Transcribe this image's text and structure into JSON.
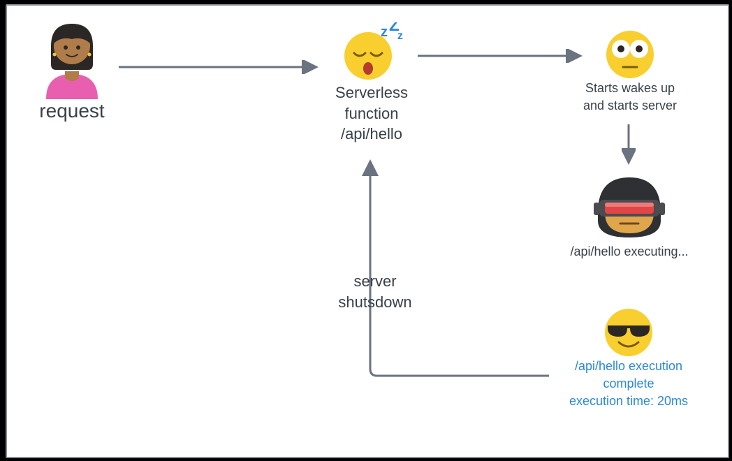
{
  "user": {
    "label": "request",
    "icon": "person-icon"
  },
  "serverless": {
    "label_line1": "Serverless",
    "label_line2": "function",
    "label_line3": "/api/hello",
    "icon": "sleepy-face-icon"
  },
  "wake": {
    "label_line1": "Starts wakes up",
    "label_line2": "and starts server",
    "icon": "wide-eyes-face-icon"
  },
  "executing": {
    "label": "/api/hello executing...",
    "icon": "robot-visor-icon"
  },
  "complete": {
    "label_line1": "/api/hello execution",
    "label_line2": "complete",
    "label_line3": "execution time: 20ms",
    "icon": "cool-sunglasses-icon"
  },
  "shutdown": {
    "label_line1": "server",
    "label_line2": "shutsdown"
  },
  "colors": {
    "arrow": "#6b7280",
    "text": "#394049",
    "link": "#2a88d8",
    "face": "#f9cf2f",
    "face_shade": "#e8b52a",
    "sleep_z": "#2a88d8",
    "person_skin": "#b07d4a",
    "person_hair": "#2b2724",
    "person_shirt": "#e85fb0",
    "robot_dark": "#2e3033",
    "robot_red": "#e24545"
  }
}
